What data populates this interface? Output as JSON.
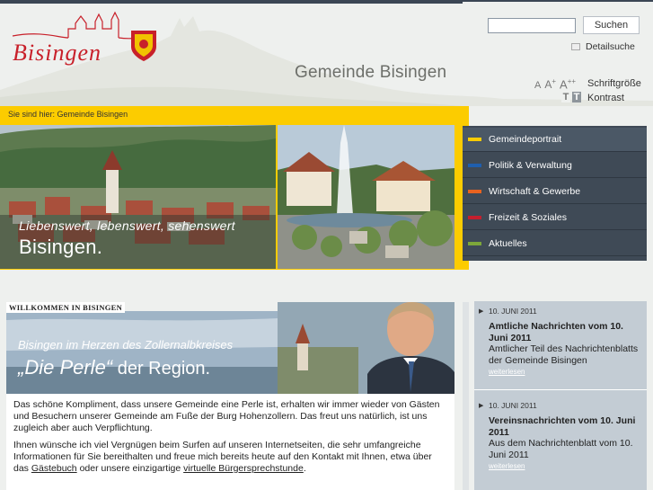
{
  "header": {
    "logo_text": "Bisingen",
    "tagline": "Gemeinde Bisingen"
  },
  "search": {
    "button_label": "Suchen",
    "input_value": "",
    "detail_label": "Detailsuche"
  },
  "accessibility": {
    "font_small": "A",
    "font_medium": "A",
    "font_medium_sup": "+",
    "font_large": "A",
    "font_large_sup": "++",
    "font_label": "Schriftgröße",
    "contrast_normal": "T",
    "contrast_high": "T",
    "contrast_label": "Kontrast"
  },
  "breadcrumb": {
    "prefix": "Sie sind hier:",
    "current": "Gemeinde Bisingen"
  },
  "hero": {
    "slogan_line1": "Liebenswert, lebenswert, sehenswert",
    "slogan_line2": "Bisingen."
  },
  "nav": {
    "items": [
      {
        "label": "Gemeindeportrait",
        "color": "#fccc00"
      },
      {
        "label": "Politik & Verwaltung",
        "color": "#1f5fae"
      },
      {
        "label": "Wirtschaft & Gewerbe",
        "color": "#e8621f"
      },
      {
        "label": "Freizeit & Soziales",
        "color": "#c41f2e"
      },
      {
        "label": "Aktuelles",
        "color": "#7da73a"
      }
    ]
  },
  "welcome": {
    "label": "WILLKOMMEN IN BISINGEN",
    "heading1": "Bisingen im Herzen des Zollernalbkreises",
    "heading2_quote": "„Die Perle“",
    "heading2_rest": " der Region.",
    "para1": "Das schöne Kompliment, dass unsere Gemeinde eine Perle ist, erhalten wir immer wieder von Gästen und Besuchern unserer Gemeinde am Fuße der Burg Hohenzollern. Das freut uns natürlich, ist uns zugleich aber auch Verpflichtung.",
    "para2_start": "Ihnen wünsche ich viel Vergnügen beim Surfen auf unseren Internetseiten, die sehr umfangreiche Informationen für Sie bereithalten und freue mich bereits heute auf den Kontakt mit Ihnen, etwa über das ",
    "link_guestbook": "Gästebuch",
    "para2_mid": " oder unsere einzigartige ",
    "link_virtual": "virtuelle Bürgersprechstunde",
    "para2_end": "."
  },
  "news": [
    {
      "date": "10. JUNI 2011",
      "title": "Amtliche Nachrichten vom 10. Juni 2011",
      "body": "Amtlicher Teil des Nachrichtenblatts der Gemeinde Bisingen",
      "more": "weiterlesen"
    },
    {
      "date": "10. JUNI 2011",
      "title": "Vereinsnachrichten vom 10. Juni 2011",
      "body": "Aus dem Nachrichtenblatt vom 10. Juni 2011",
      "more": "weiterlesen"
    }
  ]
}
